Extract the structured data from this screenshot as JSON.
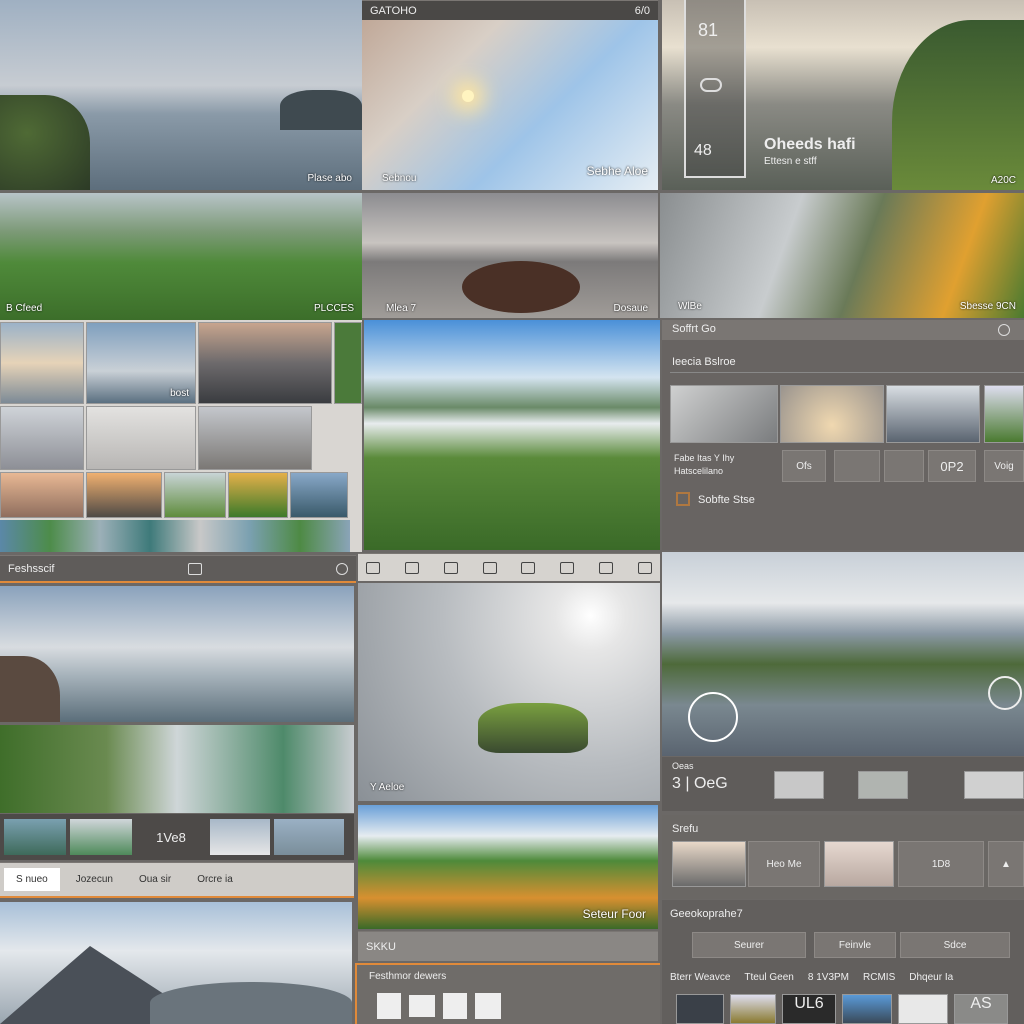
{
  "col1": {
    "tile1_caption": "Plase abo",
    "tile2_caption_left": "B Cfeed",
    "tile2_caption_right": "PLCCES",
    "grid_caption": "bost",
    "toolbar_label": "Feshsscif",
    "strip_label": "1Ve8",
    "tabs": [
      "S nueo",
      "Jozecun",
      "Oua sir",
      "Orcre ia"
    ]
  },
  "col2": {
    "top_toolbar_label": "GATOHO",
    "top_toolbar_count": "6/0",
    "tile1_caption": "Sebhe Aloe",
    "tile1_caption_left": "Sebnou",
    "tile2_caption_left": "Mlea 7",
    "tile2_caption_right": "Dosaue",
    "tile5_caption_left": "Y Aeloe",
    "tile6_caption": "Seteur Foor",
    "bar_label": "SKKU",
    "panel_title": "Festhmor dewers"
  },
  "col3": {
    "side_numbers": [
      "81",
      "48"
    ],
    "overlay_title": "Oheeds hafi",
    "overlay_sub": "Ettesn e stff",
    "tile1_caption": "A20C",
    "tile2_caption_left": "WlBe",
    "tile2_caption_right": "Sbesse 9CN",
    "panel_header": "Soffrt Go",
    "panel_section": "Ieecia Bslroe",
    "panel_row_label": [
      "Fabe Itas Y Ihy",
      "Hatscelilano"
    ],
    "panel_row_items": [
      "Ofs",
      "",
      "",
      "0P2",
      "Voig"
    ],
    "panel_footer": "Sobfte Stse",
    "row1_label": "Oeas",
    "row1_value": "3 | OeG",
    "section2_title": "Srefu",
    "section2_items": [
      "Heo Me",
      "1D8"
    ],
    "section3_title": "Geeokoprahe7",
    "section3_buttons": [
      "Seurer",
      "Feinvle",
      "Sdce"
    ],
    "bottom_line": [
      "Bterr Weavce",
      "Tteul Geen",
      "8 1V3PM",
      "RCMIS",
      "Dhqeur Ia"
    ],
    "bottom_thumb_text": [
      "UL6",
      "AS"
    ]
  },
  "colors": {
    "panel": "#5f5c5a",
    "accent": "#e08a3a"
  }
}
